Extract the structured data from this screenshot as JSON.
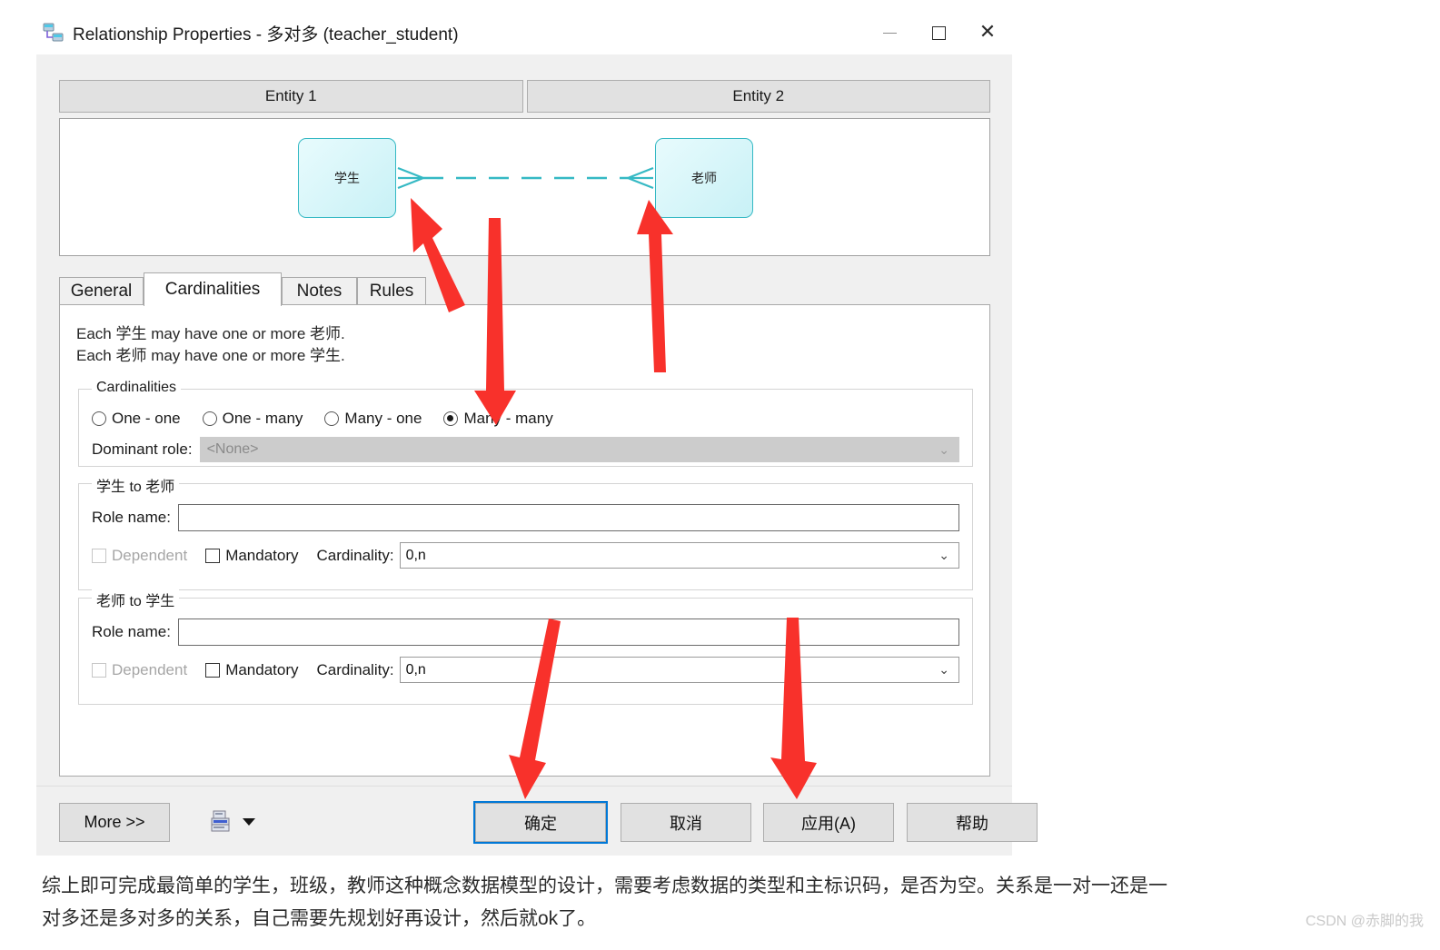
{
  "window": {
    "title": "Relationship Properties - 多对多 (teacher_student)",
    "icon": "relationship-icon",
    "minimize_label": "",
    "maximize_label": "",
    "close_label": "✕"
  },
  "entity_headers": [
    {
      "label": "Entity 1"
    },
    {
      "label": "Entity 2"
    }
  ],
  "diagram": {
    "left_entity": "学生",
    "right_entity": "老师",
    "connector": "many-to-many-dashed",
    "entity_fill": "#c8f1f6",
    "entity_border": "#35b9c4"
  },
  "tabs": [
    {
      "label": "General",
      "active": false
    },
    {
      "label": "Cardinalities",
      "active": true
    },
    {
      "label": "Notes",
      "active": false
    },
    {
      "label": "Rules",
      "active": false
    }
  ],
  "panel": {
    "description_line1": "Each 学生 may have one or more 老师.",
    "description_line2": "Each 老师 may have one or more 学生.",
    "cardinalities_group": {
      "title": "Cardinalities",
      "options": [
        {
          "label": "One - one",
          "selected": false
        },
        {
          "label": "One - many",
          "selected": false
        },
        {
          "label": "Many - one",
          "selected": false
        },
        {
          "label": "Many - many",
          "selected": true
        }
      ],
      "dominant_role_label": "Dominant role:",
      "dominant_role_value": "<None>",
      "dominant_role_disabled": true
    },
    "student_to_teacher": {
      "title": "学生 to 老师",
      "role_name_label": "Role name:",
      "role_name_value": "",
      "dependent_label": "Dependent",
      "dependent_checked": false,
      "dependent_disabled": true,
      "mandatory_label": "Mandatory",
      "mandatory_checked": false,
      "cardinality_label": "Cardinality:",
      "cardinality_value": "0,n"
    },
    "teacher_to_student": {
      "title": "老师 to 学生",
      "role_name_label": "Role name:",
      "role_name_value": "",
      "dependent_label": "Dependent",
      "dependent_checked": false,
      "dependent_disabled": true,
      "mandatory_label": "Mandatory",
      "mandatory_checked": false,
      "cardinality_label": "Cardinality:",
      "cardinality_value": "0,n"
    }
  },
  "buttons": {
    "more": "More >>",
    "print_icon": "printer-icon",
    "ok": "确定",
    "cancel": "取消",
    "apply": "应用(A)",
    "help": "帮助",
    "focused": "ok"
  },
  "annotations": {
    "color": "#f8312b",
    "count": 5
  },
  "caption": {
    "line1": "综上即可完成最简单的学生，班级，教师这种概念数据模型的设计，需要考虑数据的类型和主标识码，是否为空。关系是一对一还是一",
    "line2": "对多还是多对多的关系，自己需要先规划好再设计，然后就ok了。"
  },
  "watermark": "CSDN @赤脚的我"
}
